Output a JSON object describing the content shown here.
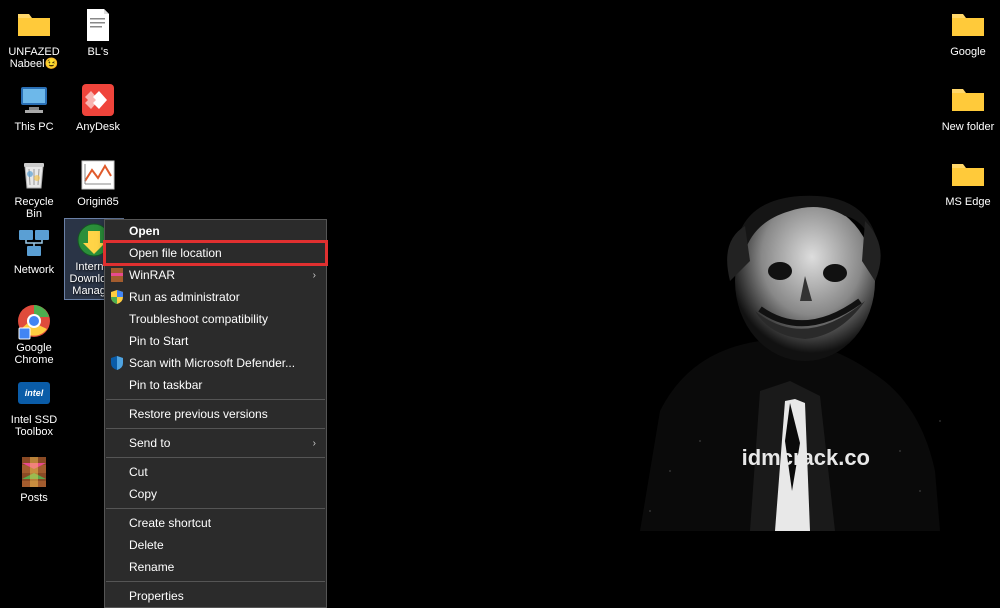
{
  "icons": {
    "unfazed": {
      "label": "UNFAZED Nabeel😉"
    },
    "bls": {
      "label": "BL's"
    },
    "thispc": {
      "label": "This PC"
    },
    "anydesk": {
      "label": "AnyDesk"
    },
    "recyclebin": {
      "label": "Recycle Bin"
    },
    "origin85": {
      "label": "Origin85"
    },
    "network": {
      "label": "Network"
    },
    "idm": {
      "label": "Internet Download Manager"
    },
    "chrome": {
      "label": "Google Chrome"
    },
    "intelssd": {
      "label": "Intel SSD Toolbox"
    },
    "posts": {
      "label": "Posts"
    },
    "google": {
      "label": "Google"
    },
    "newfolder": {
      "label": "New folder"
    },
    "msedge": {
      "label": "MS Edge"
    }
  },
  "menu": {
    "open": "Open",
    "open_file_location": "Open file location",
    "winrar": "WinRAR",
    "run_as_admin": "Run as administrator",
    "troubleshoot": "Troubleshoot compatibility",
    "pin_start": "Pin to Start",
    "scan_defender": "Scan with Microsoft Defender...",
    "pin_taskbar": "Pin to taskbar",
    "restore_versions": "Restore previous versions",
    "send_to": "Send to",
    "cut": "Cut",
    "copy": "Copy",
    "create_shortcut": "Create shortcut",
    "delete": "Delete",
    "rename": "Rename",
    "properties": "Properties"
  },
  "watermark": "idmcrack.co"
}
